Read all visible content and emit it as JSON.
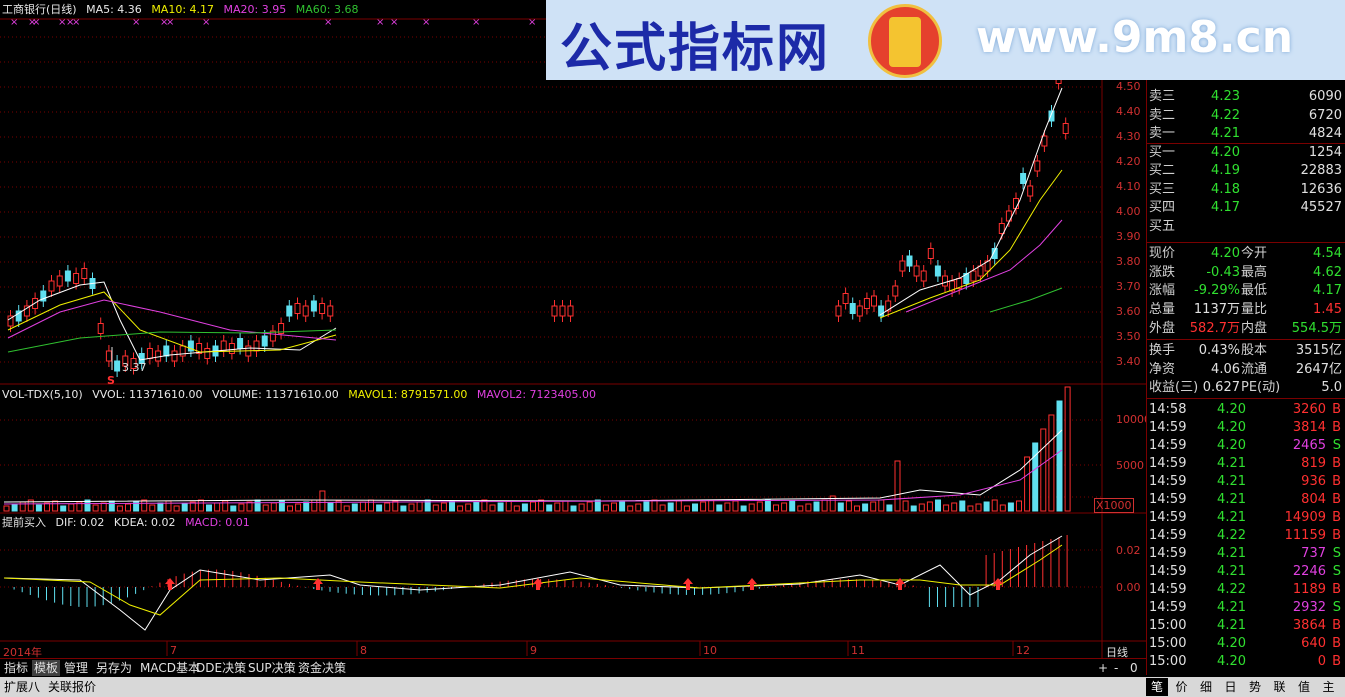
{
  "kline_legend": {
    "name": "工商银行(日线)",
    "ma5": "MA5: 4.36",
    "ma10": "MA10: 4.17",
    "ma20": "MA20: 3.95",
    "ma60": "MA60: 3.68"
  },
  "vol_legend": {
    "name": "VOL-TDX(5,10)",
    "vvol": "VVOL: 11371610.00",
    "volume": "VOLUME: 11371610.00",
    "mavol1": "MAVOL1: 8791571.00",
    "mavol2": "MAVOL2: 7123405.00"
  },
  "macd_legend": {
    "name": "提前买入",
    "dif": "DIF: 0.02",
    "kdea": "KDEA: 0.02",
    "macd": "MACD: 0.01"
  },
  "banner": {
    "title": "公式指标网",
    "url": "www.9m8.cn"
  },
  "price_axis": [
    "4.50",
    "4.40",
    "4.30",
    "4.20",
    "4.10",
    "4.00",
    "3.90",
    "3.80",
    "3.70",
    "3.60",
    "3.50",
    "3.40"
  ],
  "vol_axis": [
    "10000",
    "5000",
    "X1000"
  ],
  "macd_axis": [
    "0.02",
    "0.00"
  ],
  "low_marker": "3.37",
  "s_marker": "S",
  "date_axis": {
    "year": "2014年",
    "months": [
      "7",
      "8",
      "9",
      "10",
      "11",
      "12"
    ],
    "period": "日线"
  },
  "order_book": [
    {
      "label": "卖三",
      "price": "4.23",
      "vol": "6090",
      "color": "#30e030"
    },
    {
      "label": "卖二",
      "price": "4.22",
      "vol": "6720",
      "color": "#30e030"
    },
    {
      "label": "卖一",
      "price": "4.21",
      "vol": "4824",
      "color": "#30e030"
    },
    {
      "label": "买一",
      "price": "4.20",
      "vol": "1254",
      "color": "#30e030"
    },
    {
      "label": "买二",
      "price": "4.19",
      "vol": "22883",
      "color": "#30e030"
    },
    {
      "label": "买三",
      "price": "4.18",
      "vol": "12636",
      "color": "#30e030"
    },
    {
      "label": "买四",
      "price": "4.17",
      "vol": "45527",
      "color": "#30e030"
    },
    {
      "label": "买五",
      "price": "",
      "vol": "",
      "color": "#30e030"
    }
  ],
  "stats": [
    {
      "l1": "现价",
      "v1": "4.20",
      "c1": "#30e030",
      "l2": "今开",
      "v2": "4.54",
      "c2": "#30e030"
    },
    {
      "l1": "涨跌",
      "v1": "-0.43",
      "c1": "#30e030",
      "l2": "最高",
      "v2": "4.62",
      "c2": "#30e030"
    },
    {
      "l1": "涨幅",
      "v1": "-9.29%",
      "c1": "#30e030",
      "l2": "最低",
      "v2": "4.17",
      "c2": "#30e030"
    },
    {
      "l1": "总量",
      "v1": "1137万",
      "c1": "#e0e0e0",
      "l2": "量比",
      "v2": "1.45",
      "c2": "#ff3030"
    },
    {
      "l1": "外盘",
      "v1": "582.7万",
      "c1": "#ff3030",
      "l2": "内盘",
      "v2": "554.5万",
      "c2": "#30e030"
    }
  ],
  "fundamentals": [
    {
      "l1": "换手",
      "v1": "0.43%",
      "l2": "股本",
      "v2": "3515亿"
    },
    {
      "l1": "净资",
      "v1": "4.06",
      "l2": "流通",
      "v2": "2647亿"
    },
    {
      "l1": "收益(三)",
      "v1": "0.627",
      "l2": "PE(动)",
      "v2": "5.0"
    }
  ],
  "ticks": [
    {
      "time": "14:58",
      "price": "4.20",
      "vol": "3260",
      "bs": "B"
    },
    {
      "time": "14:59",
      "price": "4.20",
      "vol": "3814",
      "bs": "B"
    },
    {
      "time": "14:59",
      "price": "4.20",
      "vol": "2465",
      "bs": "S"
    },
    {
      "time": "14:59",
      "price": "4.21",
      "vol": "819",
      "bs": "B"
    },
    {
      "time": "14:59",
      "price": "4.21",
      "vol": "936",
      "bs": "B"
    },
    {
      "time": "14:59",
      "price": "4.21",
      "vol": "804",
      "bs": "B"
    },
    {
      "time": "14:59",
      "price": "4.21",
      "vol": "14909",
      "bs": "B"
    },
    {
      "time": "14:59",
      "price": "4.22",
      "vol": "11159",
      "bs": "B"
    },
    {
      "time": "14:59",
      "price": "4.21",
      "vol": "737",
      "bs": "S"
    },
    {
      "time": "14:59",
      "price": "4.21",
      "vol": "2246",
      "bs": "S"
    },
    {
      "time": "14:59",
      "price": "4.22",
      "vol": "1189",
      "bs": "B"
    },
    {
      "time": "14:59",
      "price": "4.21",
      "vol": "2932",
      "bs": "S"
    },
    {
      "time": "15:00",
      "price": "4.21",
      "vol": "3864",
      "bs": "B"
    },
    {
      "time": "15:00",
      "price": "4.20",
      "vol": "640",
      "bs": "B"
    },
    {
      "time": "15:00",
      "price": "4.20",
      "vol": "0",
      "bs": "B"
    }
  ],
  "tabs": [
    "指标",
    "模板",
    "管理",
    "另存为",
    "MACD基本",
    "DDE决策",
    "SUP决策",
    "资金决策"
  ],
  "tab_controls": [
    "+",
    "-",
    "0"
  ],
  "status_left": [
    "扩展八",
    "关联报价"
  ],
  "right_tabs": [
    "笔",
    "价",
    "细",
    "日",
    "势",
    "联",
    "值",
    "主"
  ],
  "colors": {
    "bg": "#000000",
    "grid": "#7a0000",
    "up": "#ff3030",
    "down": "#60e0f0",
    "ma5": "#ffffff",
    "ma10": "#f0f000",
    "ma20": "#e040e0",
    "ma60": "#30c030"
  }
}
